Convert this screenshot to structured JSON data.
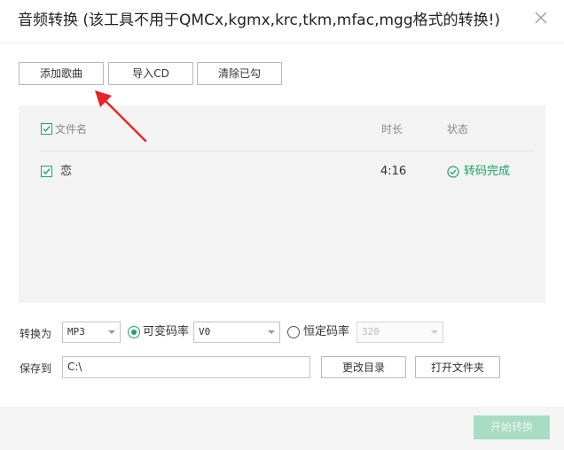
{
  "dialog": {
    "title": "音频转换 (该工具不用于QMCx,kgmx,krc,tkm,mfac,mgg格式的转换!)"
  },
  "toolbar": {
    "add_song": "添加歌曲",
    "import_cd": "导入CD",
    "clear_checked": "清除已勾"
  },
  "table": {
    "headers": {
      "name": "文件名",
      "duration": "时长",
      "status": "状态"
    },
    "rows": [
      {
        "name": "恋",
        "duration": "4:16",
        "status": "转码完成",
        "checked": true
      }
    ]
  },
  "convert": {
    "label": "转换为",
    "format": "MP3",
    "vbr_label": "可变码率",
    "vbr_value": "V0",
    "cbr_label": "恒定码率",
    "cbr_value": "320"
  },
  "save": {
    "label": "保存到",
    "path": "C:\\",
    "change_dir": "更改目录",
    "open_folder": "打开文件夹"
  },
  "footer": {
    "start": "开始转换"
  },
  "colors": {
    "accent": "#1ba36a",
    "start_disabled_bg": "#a9dcc4",
    "arrow": "#e8232a"
  }
}
